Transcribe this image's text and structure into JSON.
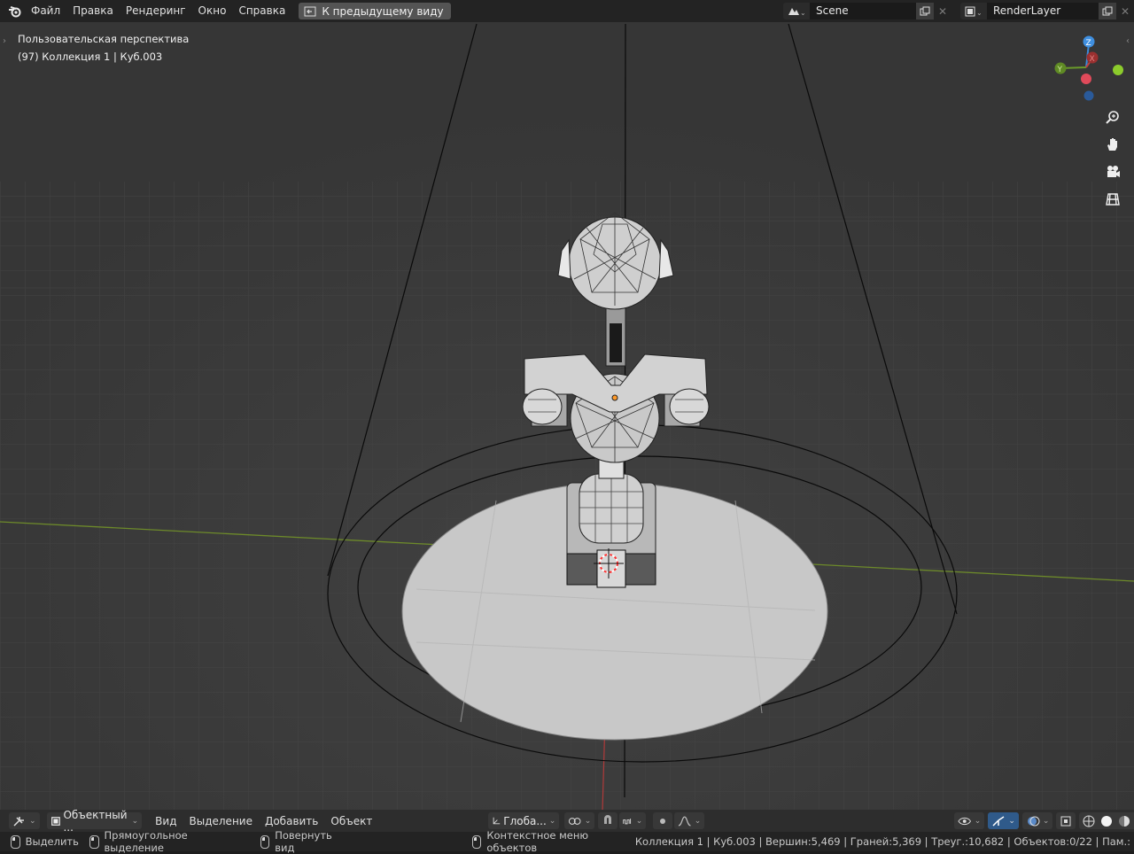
{
  "topbar": {
    "menu": [
      "Файл",
      "Правка",
      "Рендеринг",
      "Окно",
      "Справка"
    ],
    "back_button": "К предыдущему виду",
    "scene_name": "Scene",
    "render_layer": "RenderLayer"
  },
  "viewport": {
    "perspective_label": "Пользовательская перспектива",
    "collection_label": "(97) Коллекция 1 | Куб.003",
    "axis_labels": {
      "x": "X",
      "y": "Y",
      "z": "Z"
    }
  },
  "header": {
    "mode": "Объектный ...",
    "menu": [
      "Вид",
      "Выделение",
      "Добавить",
      "Объект"
    ],
    "transform_orientation": "Глоба..."
  },
  "status": {
    "select": "Выделить",
    "box_select": "Прямоугольное выделение",
    "rotate_view": "Повернуть вид",
    "context_menu": "Контекстное меню объектов",
    "stats": "Коллекция 1 | Куб.003 | Вершин:5,469 | Граней:5,369 | Треуг.:10,682 | Объектов:0/22 | Пам.:"
  }
}
